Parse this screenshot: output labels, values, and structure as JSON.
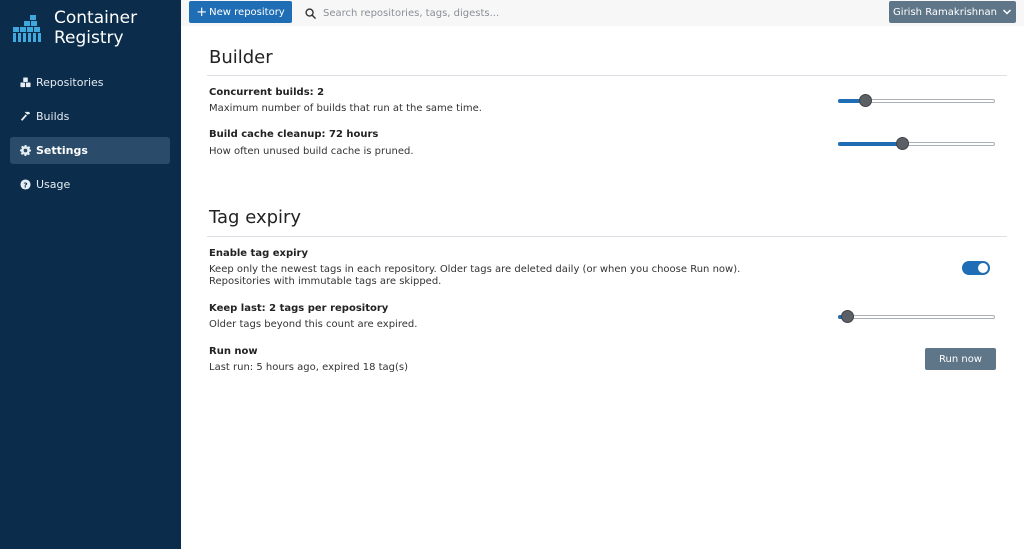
{
  "app": {
    "title_line1": "Container",
    "title_line2": "Registry"
  },
  "sidebar": {
    "items": [
      {
        "label": "Repositories",
        "icon": "cubes-icon",
        "active": false
      },
      {
        "label": "Builds",
        "icon": "hammer-icon",
        "active": false
      },
      {
        "label": "Settings",
        "icon": "gear-icon",
        "active": true
      },
      {
        "label": "Usage",
        "icon": "question-circle-icon",
        "active": false
      }
    ]
  },
  "header": {
    "new_repo_label": "New repository",
    "search_placeholder": "Search repositories, tags, digests...",
    "user_name": "Girish Ramakrishnan"
  },
  "builder": {
    "title": "Builder",
    "concurrent": {
      "label": "Concurrent builds: 2",
      "desc": "Maximum number of builds that run at the same time.",
      "value_fraction": 0.17
    },
    "cache": {
      "label": "Build cache cleanup: 72 hours",
      "desc": "How often unused build cache is pruned.",
      "value_fraction": 0.41
    }
  },
  "tag_expiry": {
    "title": "Tag expiry",
    "enable": {
      "label": "Enable tag expiry",
      "desc_line1": "Keep only the newest tags in each repository. Older tags are deleted daily (or when you choose Run now).",
      "desc_line2": "Repositories with immutable tags are skipped.",
      "enabled": true
    },
    "keep_last": {
      "label": "Keep last: 2 tags per repository",
      "desc": "Older tags beyond this count are expired.",
      "value_fraction": 0.06
    },
    "run_now": {
      "label": "Run now",
      "desc": "Last run: 5 hours ago, expired 18 tag(s)",
      "button_label": "Run now"
    }
  },
  "colors": {
    "sidebar_bg": "#0b2c4a",
    "accent": "#1f6db4",
    "secondary_button": "#5f7689"
  }
}
